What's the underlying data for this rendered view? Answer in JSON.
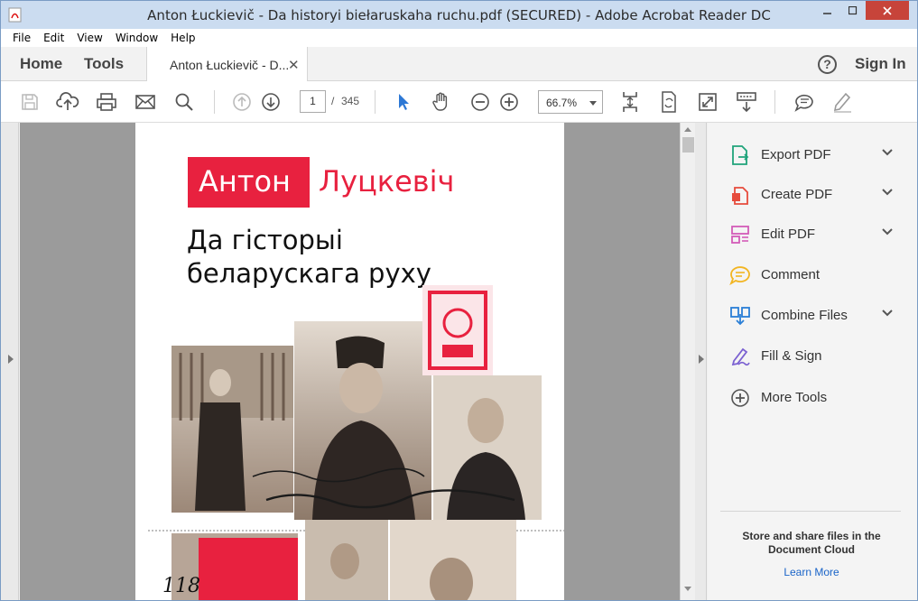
{
  "window": {
    "title": "Anton Łuckievič - Da historyi biełaruskaha ruchu.pdf (SECURED) - Adobe Acrobat Reader DC"
  },
  "menu": [
    "File",
    "Edit",
    "View",
    "Window",
    "Help"
  ],
  "nav": {
    "home": "Home",
    "tools": "Tools",
    "doc_tab": "Anton Łuckievič - D...",
    "sign_in": "Sign In",
    "help_glyph": "?"
  },
  "toolbar": {
    "icons": [
      "save-icon",
      "upload-cloud-icon",
      "print-icon",
      "email-icon",
      "search-icon",
      "page-up-icon",
      "page-down-icon",
      "select-cursor-icon",
      "hand-icon",
      "zoom-out-icon",
      "zoom-in-icon",
      "fit-page-icon",
      "rotate-icon",
      "fullscreen-icon",
      "read-mode-icon",
      "comment-icon",
      "sign-icon"
    ],
    "current_page": "1",
    "page_separator": "/",
    "total_pages": "345",
    "zoom": "66.7%"
  },
  "document": {
    "author_first": "Антон",
    "author_last": "Луцкевіч",
    "title_line1": "Да гісторыі",
    "title_line2": "беларускага руху",
    "accent_color": "#e8213f"
  },
  "sidebar": {
    "items": [
      {
        "label": "Export PDF",
        "icon": "export-pdf-icon",
        "color": "#1fa37a",
        "expandable": true
      },
      {
        "label": "Create PDF",
        "icon": "create-pdf-icon",
        "color": "#e64b3c",
        "expandable": true
      },
      {
        "label": "Edit PDF",
        "icon": "edit-pdf-icon",
        "color": "#d35cb8",
        "expandable": true
      },
      {
        "label": "Comment",
        "icon": "comment-icon",
        "color": "#f2b522",
        "expandable": false
      },
      {
        "label": "Combine Files",
        "icon": "combine-files-icon",
        "color": "#2a7fd6",
        "expandable": true
      },
      {
        "label": "Fill & Sign",
        "icon": "fill-sign-icon",
        "color": "#7b61d1",
        "expandable": false
      },
      {
        "label": "More Tools",
        "icon": "more-tools-icon",
        "color": "#555555",
        "expandable": false
      }
    ],
    "cloud_text": "Store and share files in the Document Cloud",
    "learn_more": "Learn More"
  }
}
